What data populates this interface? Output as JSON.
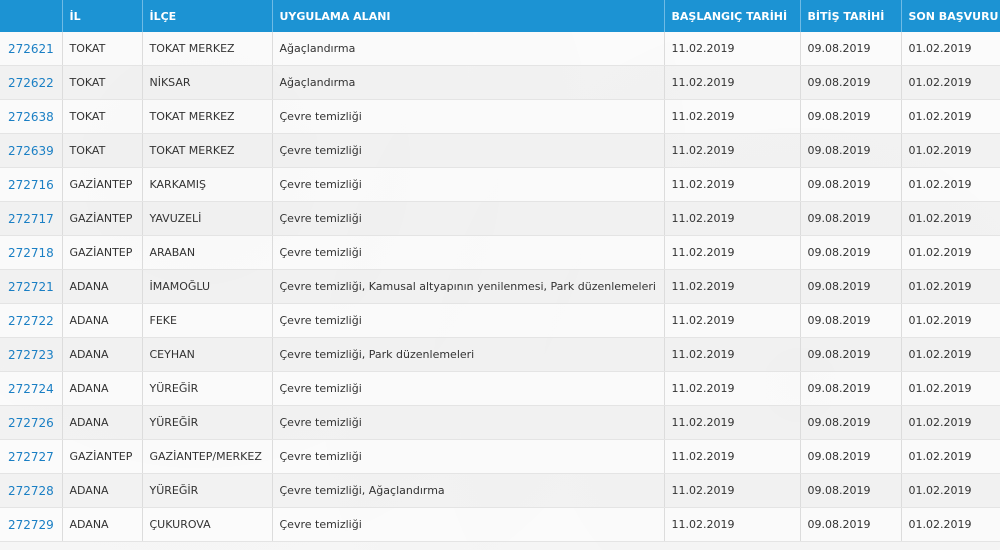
{
  "table": {
    "headers": [
      "",
      "İL",
      "İLÇE",
      "UYGULAMA ALANI",
      "BAŞLANGIÇ TARİHİ",
      "BİTİŞ TARİHİ",
      "SON BAŞVURU"
    ],
    "rows": [
      {
        "id": "272621",
        "il": "TOKAT",
        "ilce": "TOKAT MERKEZ",
        "alan": "Ağaçlandırma",
        "baslangic": "11.02.2019",
        "bitis": "09.08.2019",
        "son": "01.02.2019"
      },
      {
        "id": "272622",
        "il": "TOKAT",
        "ilce": "NİKSAR",
        "alan": "Ağaçlandırma",
        "baslangic": "11.02.2019",
        "bitis": "09.08.2019",
        "son": "01.02.2019"
      },
      {
        "id": "272638",
        "il": "TOKAT",
        "ilce": "TOKAT MERKEZ",
        "alan": "Çevre temizliği",
        "baslangic": "11.02.2019",
        "bitis": "09.08.2019",
        "son": "01.02.2019"
      },
      {
        "id": "272639",
        "il": "TOKAT",
        "ilce": "TOKAT MERKEZ",
        "alan": "Çevre temizliği",
        "baslangic": "11.02.2019",
        "bitis": "09.08.2019",
        "son": "01.02.2019"
      },
      {
        "id": "272716",
        "il": "GAZİANTEP",
        "ilce": "KARKAMIŞ",
        "alan": "Çevre temizliği",
        "baslangic": "11.02.2019",
        "bitis": "09.08.2019",
        "son": "01.02.2019"
      },
      {
        "id": "272717",
        "il": "GAZİANTEP",
        "ilce": "YAVUZELİ",
        "alan": "Çevre temizliği",
        "baslangic": "11.02.2019",
        "bitis": "09.08.2019",
        "son": "01.02.2019"
      },
      {
        "id": "272718",
        "il": "GAZİANTEP",
        "ilce": "ARABAN",
        "alan": "Çevre temizliği",
        "baslangic": "11.02.2019",
        "bitis": "09.08.2019",
        "son": "01.02.2019"
      },
      {
        "id": "272721",
        "il": "ADANA",
        "ilce": "İMAMOĞLU",
        "alan": "Çevre temizliği, Kamusal altyapının yenilenmesi, Park düzenlemeleri",
        "baslangic": "11.02.2019",
        "bitis": "09.08.2019",
        "son": "01.02.2019"
      },
      {
        "id": "272722",
        "il": "ADANA",
        "ilce": "FEKE",
        "alan": "Çevre temizliği",
        "baslangic": "11.02.2019",
        "bitis": "09.08.2019",
        "son": "01.02.2019"
      },
      {
        "id": "272723",
        "il": "ADANA",
        "ilce": "CEYHAN",
        "alan": "Çevre temizliği, Park düzenlemeleri",
        "baslangic": "11.02.2019",
        "bitis": "09.08.2019",
        "son": "01.02.2019"
      },
      {
        "id": "272724",
        "il": "ADANA",
        "ilce": "YÜREĞİR",
        "alan": "Çevre temizliği",
        "baslangic": "11.02.2019",
        "bitis": "09.08.2019",
        "son": "01.02.2019"
      },
      {
        "id": "272726",
        "il": "ADANA",
        "ilce": "YÜREĞİR",
        "alan": "Çevre temizliği",
        "baslangic": "11.02.2019",
        "bitis": "09.08.2019",
        "son": "01.02.2019"
      },
      {
        "id": "272727",
        "il": "GAZİANTEP",
        "ilce": "GAZİANTEP/MERKEZ",
        "alan": "Çevre temizliği",
        "baslangic": "11.02.2019",
        "bitis": "09.08.2019",
        "son": "01.02.2019"
      },
      {
        "id": "272728",
        "il": "ADANA",
        "ilce": "YÜREĞİR",
        "alan": "Çevre temizliği, Ağaçlandırma",
        "baslangic": "11.02.2019",
        "bitis": "09.08.2019",
        "son": "01.02.2019"
      },
      {
        "id": "272729",
        "il": "ADANA",
        "ilce": "ÇUKUROVA",
        "alan": "Çevre temizliği",
        "baslangic": "11.02.2019",
        "bitis": "09.08.2019",
        "son": "01.02.2019"
      }
    ]
  },
  "colors": {
    "header_bg": "#1c93d3",
    "link": "#1a7fc4"
  }
}
